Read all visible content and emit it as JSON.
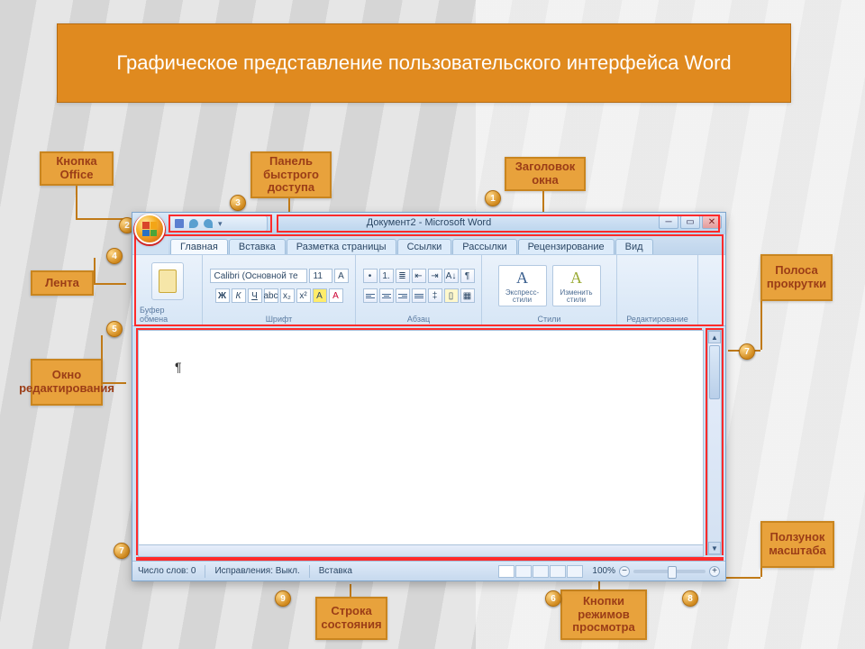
{
  "title": "Графическое представление пользовательского интерфейса Word",
  "labels": {
    "office_button": "Кнопка Office",
    "quick_access": "Панель быстрого доступа",
    "window_title": "Заголовок окна",
    "ribbon": "Лента",
    "edit_window": "Окно редактирования",
    "scrollbar": "Полоса прокрутки",
    "statusbar": "Строка состояния",
    "view_buttons": "Кнопки режимов просмотра",
    "zoom_slider": "Ползунок масштаба"
  },
  "markers": {
    "m1": "1",
    "m2": "2",
    "m3": "3",
    "m4": "4",
    "m5": "5",
    "m6": "6",
    "m7_left": "7",
    "m7_right": "7",
    "m8": "8",
    "m9": "9"
  },
  "word": {
    "doc_title": "Документ2 - Microsoft Word",
    "tabs": [
      "Главная",
      "Вставка",
      "Разметка страницы",
      "Ссылки",
      "Рассылки",
      "Рецензирование",
      "Вид"
    ],
    "ribbon_groups": {
      "clipboard": "Буфер обмена",
      "font": "Шрифт",
      "paragraph": "Абзац",
      "styles": "Стили",
      "editing": "Редактирование"
    },
    "font_name": "Calibri (Основной те",
    "font_size": "11",
    "style_btn1": "Экспресс-стили",
    "style_btn2": "Изменить стили",
    "status": {
      "words": "Число слов: 0",
      "proof": "Исправления: Выкл.",
      "insert": "Вставка"
    },
    "zoom_pct": "100%",
    "pilcrow": "¶"
  }
}
